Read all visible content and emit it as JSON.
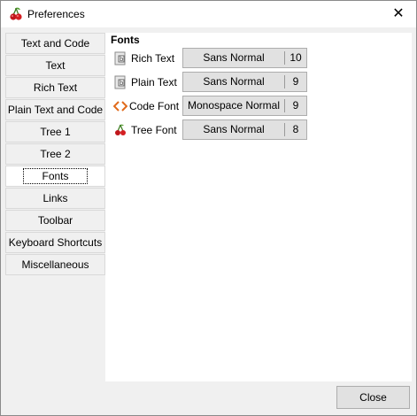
{
  "window": {
    "title": "Preferences",
    "close_glyph": "✕",
    "app_icon": "cherry-icon"
  },
  "sidebar": {
    "items": [
      {
        "label": "Text and Code",
        "selected": false
      },
      {
        "label": "Text",
        "selected": false
      },
      {
        "label": "Rich Text",
        "selected": false
      },
      {
        "label": "Plain Text and Code",
        "selected": false
      },
      {
        "label": "Tree 1",
        "selected": false
      },
      {
        "label": "Tree 2",
        "selected": false
      },
      {
        "label": "Fonts",
        "selected": true
      },
      {
        "label": "Links",
        "selected": false
      },
      {
        "label": "Toolbar",
        "selected": false
      },
      {
        "label": "Keyboard Shortcuts",
        "selected": false
      },
      {
        "label": "Miscellaneous",
        "selected": false
      }
    ]
  },
  "fonts_panel": {
    "title": "Fonts",
    "rows": [
      {
        "label": "Rich Text",
        "icon": "rich-text-icon",
        "font": "Sans Normal",
        "size": "10"
      },
      {
        "label": "Plain Text",
        "icon": "plain-text-icon",
        "font": "Sans Normal",
        "size": "9"
      },
      {
        "label": "Code Font",
        "icon": "code-icon",
        "font": "Monospace Normal",
        "size": "9"
      },
      {
        "label": "Tree Font",
        "icon": "cherry-icon",
        "font": "Sans Normal",
        "size": "8"
      }
    ]
  },
  "footer": {
    "close_label": "Close"
  }
}
